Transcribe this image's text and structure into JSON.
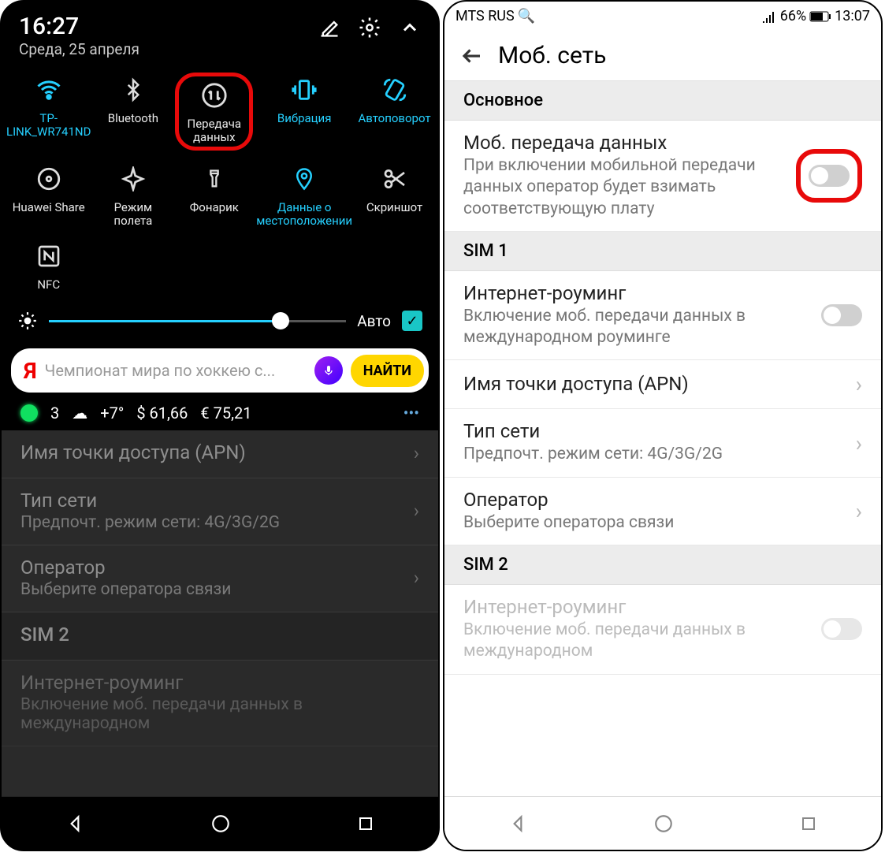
{
  "left": {
    "time": "16:27",
    "date": "Среда, 25 апреля",
    "tiles": [
      {
        "label": "TP-LINK_WR741ND",
        "state": "active"
      },
      {
        "label": "Bluetooth",
        "state": "inactive"
      },
      {
        "label": "Передача данных",
        "state": "inactive",
        "highlight": true
      },
      {
        "label": "Вибрация",
        "state": "active"
      },
      {
        "label": "Автоповорот",
        "state": "active"
      },
      {
        "label": "Huawei Share",
        "state": "inactive"
      },
      {
        "label": "Режим полета",
        "state": "inactive"
      },
      {
        "label": "Фонарик",
        "state": "inactive"
      },
      {
        "label": "Данные о местоположении",
        "state": "active"
      },
      {
        "label": "Скриншот",
        "state": "inactive"
      },
      {
        "label": "NFC",
        "state": "inactive"
      }
    ],
    "brightness": {
      "auto_label": "Авто",
      "auto_checked": true
    },
    "yandex": {
      "placeholder": "Чемпионат мира по хоккею с...",
      "button": "НАЙТИ"
    },
    "ticker": {
      "notif": "3",
      "weather": "+7°",
      "usd": "$ 61,66",
      "eur": "€ 75,21"
    },
    "rows": [
      {
        "t": "Имя точки доступа (APN)",
        "s": ""
      },
      {
        "t": "Тип сети",
        "s": "Предпочт. режим сети: 4G/3G/2G"
      },
      {
        "t": "Оператор",
        "s": "Выберите оператора связи"
      }
    ],
    "sim2": "SIM 2",
    "roaming_disabled": {
      "t": "Интернет-роуминг",
      "s": "Включение моб. передачи данных в международном"
    }
  },
  "right": {
    "carrier": "MTS RUS",
    "battery": "66%",
    "time": "13:07",
    "title": "Моб. сеть",
    "sect_main": "Основное",
    "mob_data": {
      "t": "Моб. передача данных",
      "s": "При включении мобильной передачи данных оператор будет взимать соответствующую плату"
    },
    "sim1": "SIM 1",
    "roaming": {
      "t": "Интернет-роуминг",
      "s": "Включение моб. передачи данных в международном роуминге"
    },
    "apn": {
      "t": "Имя точки доступа (APN)"
    },
    "net_type": {
      "t": "Тип сети",
      "s": "Предпочт. режим сети: 4G/3G/2G"
    },
    "operator": {
      "t": "Оператор",
      "s": "Выберите оператора связи"
    },
    "sim2": "SIM 2",
    "roaming2": {
      "t": "Интернет-роуминг",
      "s": "Включение моб. передачи данных в международном"
    }
  }
}
